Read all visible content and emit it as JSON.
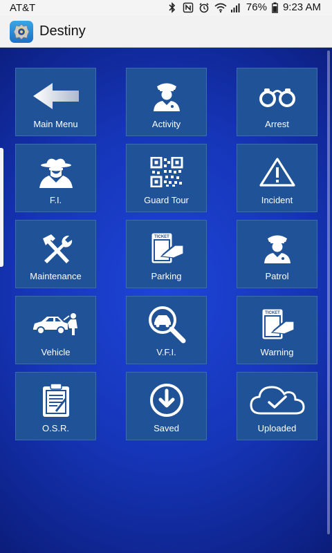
{
  "status_bar": {
    "carrier": "AT&T",
    "battery": "76%",
    "time": "9:23 AM",
    "icons": [
      "bluetooth-icon",
      "nfc-icon",
      "alarm-icon",
      "wifi-icon",
      "signal-icon",
      "battery-icon"
    ]
  },
  "app_bar": {
    "title": "Destiny",
    "logo_icon": "police-badge-icon"
  },
  "colors": {
    "tile": "#1f5296",
    "background_center": "#1e45d8",
    "background_edge": "#070f4c",
    "label": "#ffffff"
  },
  "tiles": [
    {
      "label": "Main Menu",
      "icon": "back-arrow-icon"
    },
    {
      "label": "Activity",
      "icon": "police-officer-icon"
    },
    {
      "label": "Arrest",
      "icon": "handcuffs-icon"
    },
    {
      "label": "F.I.",
      "icon": "detective-icon"
    },
    {
      "label": "Guard Tour",
      "icon": "qr-code-icon"
    },
    {
      "label": "Incident",
      "icon": "warning-triangle-icon"
    },
    {
      "label": "Maintenance",
      "icon": "tools-icon"
    },
    {
      "label": "Parking",
      "icon": "parking-ticket-icon"
    },
    {
      "label": "Patrol",
      "icon": "patrol-officer-icon"
    },
    {
      "label": "Vehicle",
      "icon": "car-repair-icon"
    },
    {
      "label": "V.F.I.",
      "icon": "car-search-icon"
    },
    {
      "label": "Warning",
      "icon": "warning-ticket-icon"
    },
    {
      "label": "O.S.R.",
      "icon": "clipboard-icon"
    },
    {
      "label": "Saved",
      "icon": "download-circle-icon"
    },
    {
      "label": "Uploaded",
      "icon": "cloud-check-icon"
    }
  ],
  "ticket_text": "TICKET"
}
